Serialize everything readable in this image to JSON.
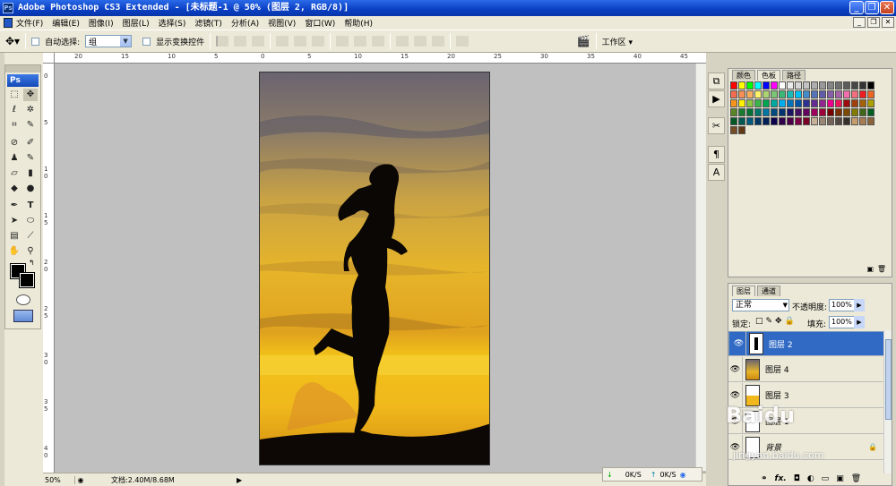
{
  "window": {
    "title": "Adobe Photoshop CS3 Extended - [未标题-1 @ 50% (图层 2, RGB/8)]",
    "app_icon": "Ps"
  },
  "menu": [
    "文件(F)",
    "编辑(E)",
    "图像(I)",
    "图层(L)",
    "选择(S)",
    "滤镜(T)",
    "分析(A)",
    "视图(V)",
    "窗口(W)",
    "帮助(H)"
  ],
  "options": {
    "auto_select_label": "自动选择:",
    "auto_select_value": "组",
    "show_transform_label": "显示变换控件",
    "workspace_label": "工作区 ▾"
  },
  "toolbox": {
    "logo": "Ps"
  },
  "ruler_top": [
    "20",
    "15",
    "10",
    "5",
    "0",
    "5",
    "10",
    "15",
    "20",
    "25",
    "30",
    "35",
    "40",
    "45"
  ],
  "ruler_left": [
    "0",
    "5",
    "1 0",
    "1 5",
    "2 0",
    "2 5",
    "3 0",
    "3 5",
    "4 0"
  ],
  "status": {
    "zoom": "50%",
    "doc_info": "文档:2.40M/8.68M"
  },
  "network": {
    "down": "0K/S",
    "up": "0K/S"
  },
  "swatches": {
    "tabs": [
      "颜色",
      "色板",
      "路径"
    ],
    "colors": [
      "#ff0000",
      "#ffff00",
      "#00ff00",
      "#00ffff",
      "#0000ff",
      "#ff00ff",
      "#ffffff",
      "#ebebeb",
      "#d6d6d6",
      "#c2c2c2",
      "#adadad",
      "#999999",
      "#858585",
      "#707070",
      "#5c5c5c",
      "#474747",
      "#333333",
      "#000000",
      "#f26c4f",
      "#f68e55",
      "#fbaf5d",
      "#fff467",
      "#acd372",
      "#7cc576",
      "#3bb878",
      "#1abbb4",
      "#00bff3",
      "#438ccb",
      "#5574b9",
      "#605ca8",
      "#855fa8",
      "#a763a8",
      "#f06ea9",
      "#f26d7d",
      "#ee1d24",
      "#f16522",
      "#f7941d",
      "#fff200",
      "#8dc63f",
      "#39b54a",
      "#00a650",
      "#00a99d",
      "#00aeef",
      "#0072bc",
      "#0054a5",
      "#2e3192",
      "#652d90",
      "#92278f",
      "#ec008c",
      "#ed145b",
      "#9e0b0f",
      "#a0410d",
      "#a3620a",
      "#aba000",
      "#598527",
      "#1a7b30",
      "#007236",
      "#00746b",
      "#0076a3",
      "#004b80",
      "#003471",
      "#1b1464",
      "#440e62",
      "#630460",
      "#9e005d",
      "#9e0039",
      "#790000",
      "#7b2e00",
      "#7d4900",
      "#827b00",
      "#406618",
      "#005e20",
      "#005826",
      "#005952",
      "#005b7f",
      "#003663",
      "#002157",
      "#0d004c",
      "#32004b",
      "#4b0049",
      "#7b0046",
      "#7a0026",
      "#c7b299",
      "#998675",
      "#736357",
      "#534741",
      "#37302a",
      "#c69c6d",
      "#a67c52",
      "#8c6239",
      "#754c24",
      "#603913"
    ]
  },
  "layers": {
    "tabs": [
      "图层",
      "通道"
    ],
    "blend_mode": "正常",
    "opacity_label": "不透明度:",
    "opacity_value": "100%",
    "lock_label": "锁定:",
    "fill_label": "填充:",
    "fill_value": "100%",
    "items": [
      {
        "name": "图层 2",
        "selected": true
      },
      {
        "name": "图层 4",
        "selected": false
      },
      {
        "name": "图层 3",
        "selected": false
      },
      {
        "name": "图层 1",
        "selected": false
      },
      {
        "name": "背景",
        "selected": false
      }
    ],
    "bottom_icons": [
      "link-icon",
      "fx-icon",
      "mask-icon",
      "adjustment-icon",
      "folder-icon",
      "new-layer-icon",
      "trash-icon"
    ]
  },
  "watermark": {
    "text": "Baidu",
    "url": "jingyan.baidu.com"
  }
}
